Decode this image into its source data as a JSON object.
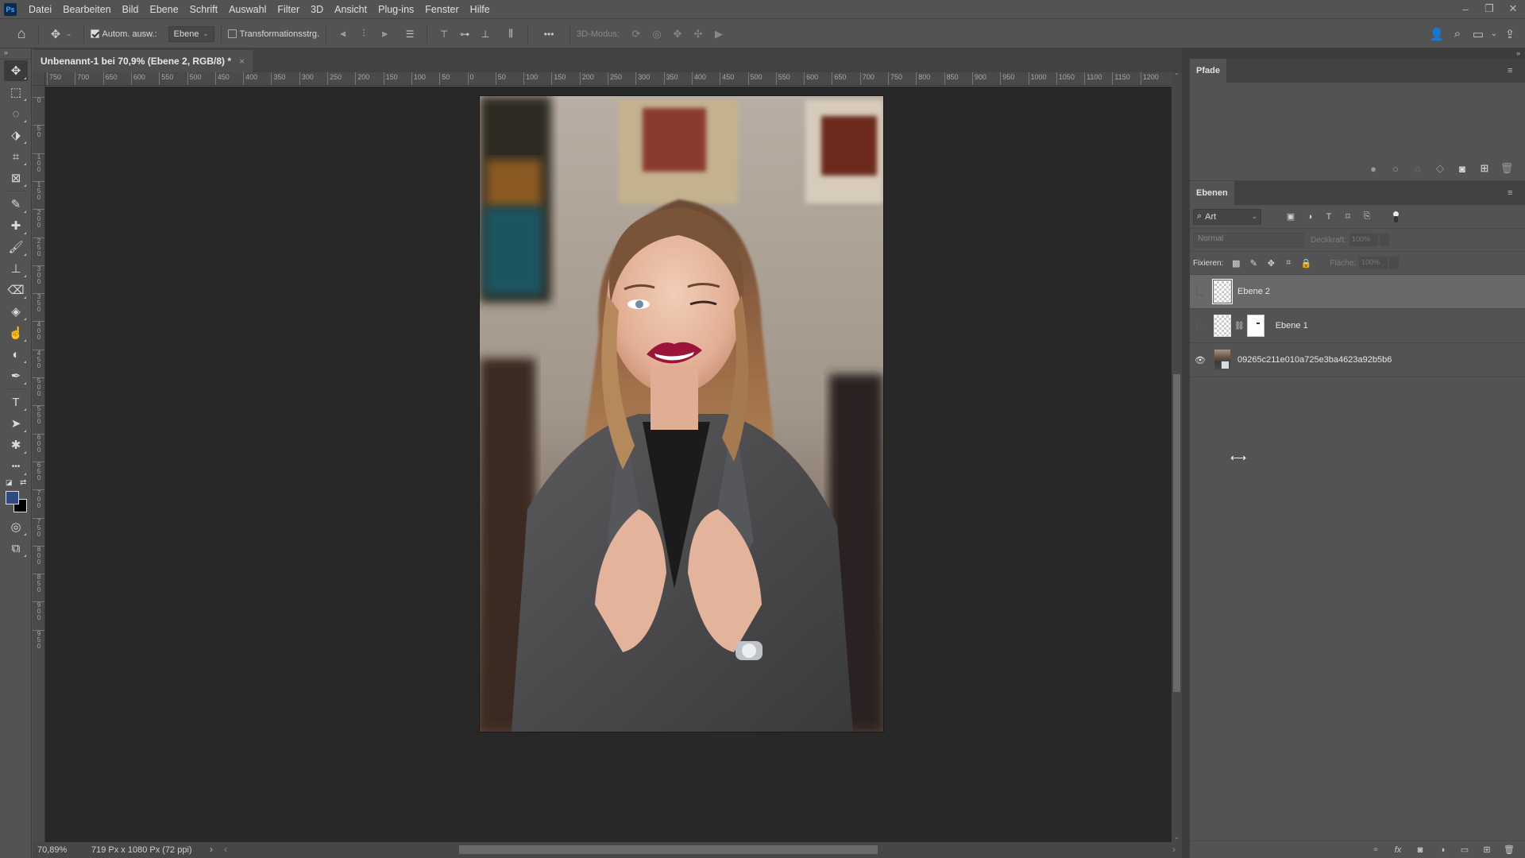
{
  "app": {
    "logo": "Ps"
  },
  "menu": [
    "Datei",
    "Bearbeiten",
    "Bild",
    "Ebene",
    "Schrift",
    "Auswahl",
    "Filter",
    "3D",
    "Ansicht",
    "Plug-ins",
    "Fenster",
    "Hilfe"
  ],
  "window_controls": {
    "minimize": "–",
    "restore": "❐",
    "close": "✕"
  },
  "options_bar": {
    "home_icon": "⌂",
    "move_icon": "✥",
    "auto_select_label": "Autom. ausw.:",
    "auto_select_checked": true,
    "auto_select_target": "Ebene",
    "transform_controls_label": "Transformationsstrg.",
    "transform_controls_checked": false,
    "more_label": "•••",
    "mode_3d_label": "3D-Modus:"
  },
  "document": {
    "tab_title": "Unbenannt-1 bei 70,9% (Ebene 2, RGB/8) *",
    "close": "×",
    "zoom": "70,89%",
    "size_info": "719 Px x 1080 Px (72 ppi)",
    "status_next": "›",
    "status_prev": "‹"
  },
  "ruler_top": [
    "750",
    "700",
    "650",
    "600",
    "550",
    "500",
    "450",
    "400",
    "350",
    "300",
    "250",
    "200",
    "150",
    "100",
    "50",
    "0",
    "50",
    "100",
    "150",
    "200",
    "250",
    "300",
    "350",
    "400",
    "450",
    "500",
    "550",
    "600",
    "650",
    "700",
    "750",
    "800",
    "850",
    "900",
    "950",
    "1000",
    "1050",
    "1100",
    "1150",
    "1200"
  ],
  "ruler_left": [
    "0",
    "50",
    "100",
    "150",
    "200",
    "250",
    "300",
    "350",
    "400",
    "450",
    "500",
    "550",
    "600",
    "650",
    "700",
    "750",
    "800",
    "850",
    "900",
    "950"
  ],
  "toolbar": {
    "collapse": "»",
    "tools": [
      {
        "name": "move-tool",
        "icon": "✥",
        "active": true
      },
      {
        "name": "marquee-tool",
        "icon": "⬚"
      },
      {
        "name": "lasso-tool",
        "icon": "◌"
      },
      {
        "name": "object-selection-tool",
        "icon": "⬗"
      },
      {
        "name": "crop-tool",
        "icon": "⌗"
      },
      {
        "name": "frame-tool",
        "icon": "⊠"
      },
      {
        "name": "eyedropper-tool",
        "icon": "✎"
      },
      {
        "name": "healing-brush-tool",
        "icon": "✚"
      },
      {
        "name": "brush-tool",
        "icon": "🖌"
      },
      {
        "name": "clone-stamp-tool",
        "icon": "⊥"
      },
      {
        "name": "eraser-tool",
        "icon": "⌫"
      },
      {
        "name": "paint-bucket-tool",
        "icon": "◈"
      },
      {
        "name": "smudge-tool",
        "icon": "☝"
      },
      {
        "name": "dodge-tool",
        "icon": "◐"
      },
      {
        "name": "pen-tool",
        "icon": "✒"
      },
      {
        "name": "type-tool",
        "icon": "T"
      },
      {
        "name": "path-selection-tool",
        "icon": "➤"
      },
      {
        "name": "custom-shape-tool",
        "icon": "✱"
      },
      {
        "name": "more-tools",
        "icon": "•••"
      }
    ],
    "foreground_color": "#2f4a82",
    "background_color": "#000000",
    "bottom_tools": [
      {
        "name": "quick-mask-button",
        "icon": "◎"
      },
      {
        "name": "screen-mode-button",
        "icon": "⧉"
      }
    ]
  },
  "panels": {
    "collapse": "»",
    "paths": {
      "tab": "Pfade",
      "menu_icon": "≡",
      "footer_icons": [
        {
          "name": "fill-path-icon",
          "glyph": "●"
        },
        {
          "name": "stroke-path-icon",
          "glyph": "○"
        },
        {
          "name": "load-as-selection-icon",
          "glyph": "◌"
        },
        {
          "name": "make-work-path-icon",
          "glyph": "◇"
        },
        {
          "name": "add-mask-icon",
          "glyph": "◙"
        },
        {
          "name": "new-path-icon",
          "glyph": "⊞"
        },
        {
          "name": "delete-path-icon",
          "glyph": "🗑"
        }
      ]
    },
    "layers": {
      "tab": "Ebenen",
      "menu_icon": "≡",
      "filter_label": "Art",
      "filter_icons": [
        {
          "name": "pixel-layer-filter-icon",
          "glyph": "▣"
        },
        {
          "name": "adjustment-layer-filter-icon",
          "glyph": "◑"
        },
        {
          "name": "type-layer-filter-icon",
          "glyph": "T"
        },
        {
          "name": "shape-layer-filter-icon",
          "glyph": "⌑"
        },
        {
          "name": "smart-object-filter-icon",
          "glyph": "⎘"
        }
      ],
      "blend_mode": "Normal",
      "opacity_label": "Deckkraft:",
      "opacity_value": "100%",
      "lock_label": "Fixieren:",
      "lock_icons": [
        {
          "name": "lock-transparent-pixels-icon",
          "glyph": "▩"
        },
        {
          "name": "lock-image-pixels-icon",
          "glyph": "✎"
        },
        {
          "name": "lock-position-icon",
          "glyph": "✥"
        },
        {
          "name": "lock-artboard-icon",
          "glyph": "⌗"
        },
        {
          "name": "lock-all-icon",
          "glyph": "🔒"
        }
      ],
      "fill_label": "Fläche:",
      "fill_value": "100%",
      "items": [
        {
          "name": "Ebene 2",
          "visible": false,
          "selected": true,
          "type": "transparent"
        },
        {
          "name": "Ebene 1",
          "visible": false,
          "selected": false,
          "type": "masked"
        },
        {
          "name": "09265c211e010a725e3ba4623a92b5b6",
          "visible": true,
          "selected": false,
          "type": "smart-object"
        }
      ],
      "footer_icons": [
        {
          "name": "link-layers-icon",
          "glyph": "⚭"
        },
        {
          "name": "layer-style-icon",
          "glyph": "fx"
        },
        {
          "name": "add-layer-mask-icon",
          "glyph": "◙"
        },
        {
          "name": "new-adjustment-layer-icon",
          "glyph": "◑"
        },
        {
          "name": "new-group-icon",
          "glyph": "▭"
        },
        {
          "name": "new-layer-icon",
          "glyph": "⊞"
        },
        {
          "name": "delete-layer-icon",
          "glyph": "🗑"
        }
      ]
    }
  },
  "right_options_icons": [
    {
      "name": "share-user-icon",
      "glyph": "👤"
    },
    {
      "name": "search-icon",
      "glyph": "⌕"
    },
    {
      "name": "workspace-icon",
      "glyph": "▭"
    },
    {
      "name": "workspace-dropdown-icon",
      "glyph": "⌄"
    },
    {
      "name": "share-icon",
      "glyph": "⇪"
    }
  ],
  "cursor": "⟷"
}
